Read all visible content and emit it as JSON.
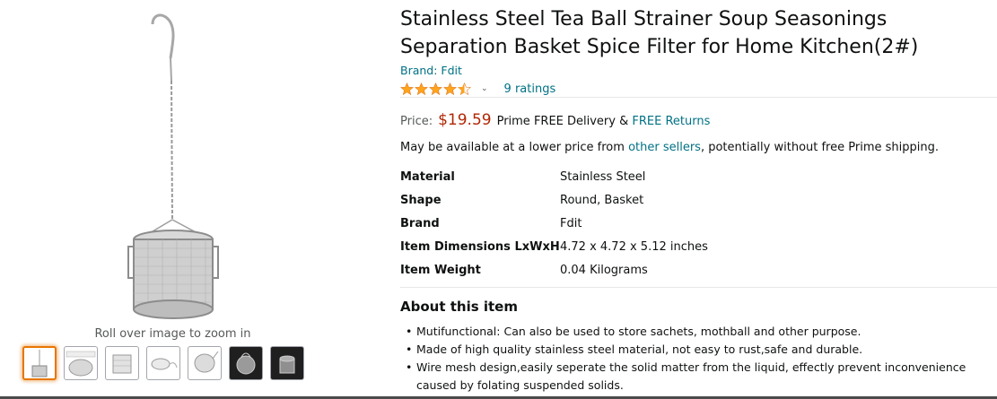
{
  "gallery": {
    "zoom_hint": "Roll over image to zoom in"
  },
  "product": {
    "title": "Stainless Steel Tea Ball Strainer Soup Seasonings Separation Basket Spice Filter for Home Kitchen(2#)",
    "brand_link": "Brand: Fdit",
    "rating_value": 4.5,
    "ratings_count": "9 ratings"
  },
  "price": {
    "label": "Price:",
    "value": "$19.59",
    "prime_text": "Prime FREE Delivery &",
    "returns_link": "FREE Returns"
  },
  "availability": {
    "prefix": "May be available at a lower price from",
    "link": "other sellers",
    "suffix": ", potentially without free Prime shipping."
  },
  "specs": [
    {
      "key": "Material",
      "value": "Stainless Steel"
    },
    {
      "key": "Shape",
      "value": "Round, Basket"
    },
    {
      "key": "Brand",
      "value": "Fdit"
    },
    {
      "key": "Item Dimensions LxWxH",
      "value": "4.72 x 4.72 x 5.12 inches"
    },
    {
      "key": "Item Weight",
      "value": "0.04 Kilograms"
    }
  ],
  "about": {
    "title": "About this item",
    "bullets": [
      "Mutifunctional: Can also be used to store sachets, mothball and other purpose.",
      "Made of high quality stainless steel material, not easy to rust,safe and durable.",
      "Wire mesh design,easily seperate the solid matter from the liquid, effectly prevent inconvenience caused by folating suspended solids."
    ]
  },
  "colors": {
    "link": "#007185",
    "price": "#b12704",
    "star": "#ffa41c",
    "selected_thumb_border": "#e77600"
  },
  "icons": [
    "star-full-icon",
    "star-half-icon",
    "chevron-down-icon"
  ]
}
